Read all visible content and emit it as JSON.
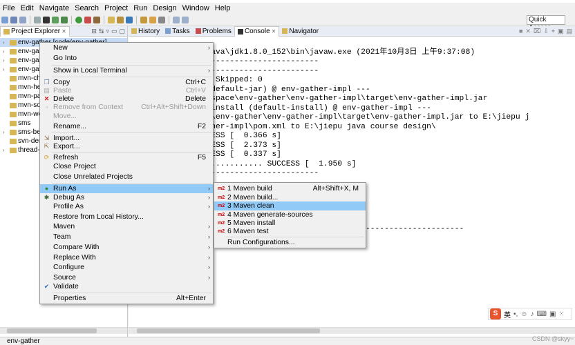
{
  "menubar": [
    "File",
    "Edit",
    "Navigate",
    "Search",
    "Project",
    "Run",
    "Design",
    "Window",
    "Help"
  ],
  "quick_access": "Quick Access",
  "left_panel": {
    "tab": "Project Explorer",
    "items": [
      "env-gather [code/env-gather]",
      "env-gat",
      "env-gat",
      "env-gat",
      "mvn-chi",
      "mvn-hel",
      "mvn-pa",
      "mvn-sou",
      "mvn-we",
      "sms",
      "sms-bea",
      "svn-den",
      "thread-p"
    ]
  },
  "right_tabs": [
    "History",
    "Tasks",
    "Problems",
    "Console",
    "Navigator"
  ],
  "console_lines": [
    "<terminated> E:\\java\\jdk1.8.0_152\\bin\\javaw.exe (2021年10月3日 上午9:37:08)",
    "----------------------------------------",
    "",
    "----------------------------------------",
    "",
    "",
    "",
    "es: 0, Errors: 0, Skipped: 0",
    "",
    "",
    "-plugin:2.4:jar (default-jar) @ env-gather-impl ---",
    "   E:\\jd2107\\workspace\\env-gather\\env-gather-impl\\target\\env-gather-impl.jar",
    "",
    "stall-plugin:2.4:install (default-install) @ env-gather-impl ---",
    "\\jd2107\\workspace\\env-gather\\env-gather-impl\\target\\env-gather-impl.jar to E:\\jiepu j",
    "               ather-impl\\pom.xml to E:\\jiepu java course design\\",
    "",
    "",
    "",
    "............ SUCCESS [  0.366 s]",
    "............ SUCCESS [  2.373 s]",
    "............ SUCCESS [  0.337 s]",
    "pl ......................... SUCCESS [  1.950 s]",
    "----------------------------------------",
    ".",
    "----------------------------------------",
    ".118 s",
    " 2021-10-03T09:37:14+08:00",
    "[INFO] Final Memory: 17M/154M",
    "[INFO] ----------------------------------------------------------------"
  ],
  "context_menu": {
    "new": "New",
    "go_into": "Go Into",
    "show_terminal": "Show in Local Terminal",
    "copy": "Copy",
    "copy_sc": "Ctrl+C",
    "paste": "Paste",
    "paste_sc": "Ctrl+V",
    "delete": "Delete",
    "delete_sc": "Delete",
    "remove_ctx": "Remove from Context",
    "remove_ctx_sc": "Ctrl+Alt+Shift+Down",
    "move": "Move...",
    "rename": "Rename...",
    "rename_sc": "F2",
    "import": "Import...",
    "export": "Export...",
    "refresh": "Refresh",
    "refresh_sc": "F5",
    "close_project": "Close Project",
    "close_unrelated": "Close Unrelated Projects",
    "run_as": "Run As",
    "debug_as": "Debug As",
    "profile_as": "Profile As",
    "restore_history": "Restore from Local History...",
    "maven": "Maven",
    "team": "Team",
    "compare_with": "Compare With",
    "replace_with": "Replace With",
    "configure": "Configure",
    "source": "Source",
    "validate": "Validate",
    "properties": "Properties",
    "properties_sc": "Alt+Enter"
  },
  "run_as_menu": {
    "i1": "1 Maven build",
    "i1_sc": "Alt+Shift+X, M",
    "i2": "2 Maven build...",
    "i3": "3 Maven clean",
    "i4": "4 Maven generate-sources",
    "i5": "5 Maven install",
    "i6": "6 Maven test",
    "run_conf": "Run Configurations...",
    "m2_badge": "m2"
  },
  "statusbar": "env-gather",
  "ime": {
    "logo": "S",
    "lang": "英"
  },
  "watermark": "CSDN @skyy~"
}
